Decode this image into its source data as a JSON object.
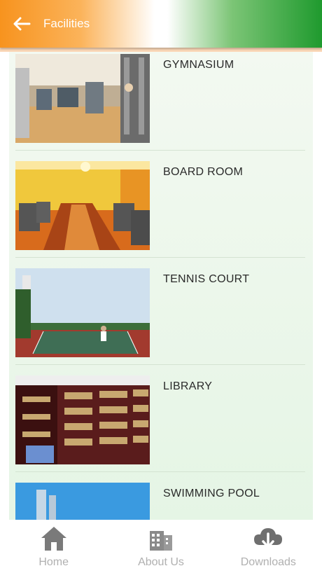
{
  "header": {
    "title": "Facilities"
  },
  "facilities": [
    {
      "label": "GYMNASIUM"
    },
    {
      "label": "BOARD ROOM"
    },
    {
      "label": "TENNIS COURT"
    },
    {
      "label": "LIBRARY"
    },
    {
      "label": "SWIMMING POOL"
    }
  ],
  "bottom_nav": [
    {
      "label": "Home",
      "icon": "home-icon"
    },
    {
      "label": "About Us",
      "icon": "building-icon"
    },
    {
      "label": "Downloads",
      "icon": "cloud-download-icon"
    }
  ],
  "colors": {
    "saffron": "#f7931e",
    "green": "#1f9a2e",
    "nav_text": "#b0b0b0"
  }
}
